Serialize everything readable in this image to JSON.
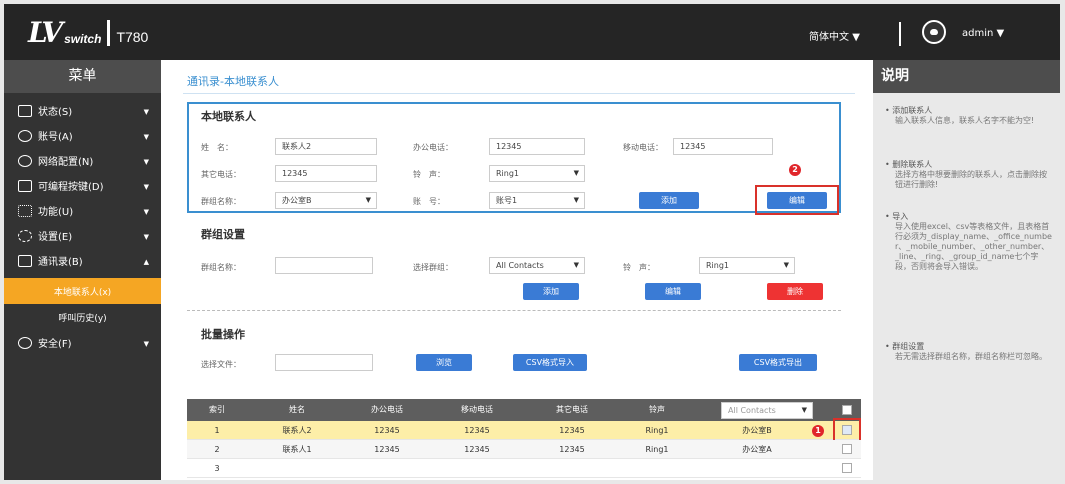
{
  "header": {
    "logo_main": "LV",
    "logo_sub": "switch",
    "model": "T780",
    "language": "简体中文",
    "user": "admin"
  },
  "sidebar": {
    "title": "菜单",
    "items": [
      {
        "label": "状态(S)",
        "caret": "▼"
      },
      {
        "label": "账号(A)",
        "caret": "▼"
      },
      {
        "label": "网络配置(N)",
        "caret": "▼"
      },
      {
        "label": "可编程按键(D)",
        "caret": "▼"
      },
      {
        "label": "功能(U)",
        "caret": "▼"
      },
      {
        "label": "设置(E)",
        "caret": "▼"
      },
      {
        "label": "通讯录(B)",
        "caret": "▲"
      }
    ],
    "subitems": [
      {
        "label": "本地联系人(x)"
      },
      {
        "label": "呼叫历史(y)"
      }
    ],
    "security": {
      "label": "安全(F)",
      "caret": "▼"
    }
  },
  "breadcrumb": "通讯录-本地联系人",
  "contact_form": {
    "title": "本地联系人",
    "name_label": "姓　名：",
    "name_value": "联系人2",
    "office_label": "办公电话：",
    "office_value": "12345",
    "mobile_label": "移动电话：",
    "mobile_value": "12345",
    "other_label": "其它电话：",
    "other_value": "12345",
    "ring_label": "铃　声：",
    "ring_value": "Ring1",
    "group_label": "群组名称：",
    "group_value": "办公室B",
    "account_label": "账　号：",
    "account_value": "账号1",
    "add_button": "添加",
    "edit_button": "编辑",
    "badge": "2"
  },
  "group_section": {
    "title": "群组设置",
    "name_label": "群组名称：",
    "name_value": "",
    "select_label": "选择群组：",
    "select_value": "All Contacts",
    "ring_label": "铃　声：",
    "ring_value": "Ring1",
    "add_button": "添加",
    "edit_button": "编辑",
    "delete_button": "删除"
  },
  "batch_section": {
    "title": "批量操作",
    "file_label": "选择文件：",
    "file_value": "",
    "browse_button": "浏览",
    "import_button": "CSV格式导入",
    "export_button": "CSV格式导出"
  },
  "table": {
    "columns": [
      "索引",
      "姓名",
      "办公电话",
      "移动电话",
      "其它电话",
      "铃声"
    ],
    "filter": "All Contacts",
    "rows": [
      {
        "index": "1",
        "name": "联系人2",
        "office": "12345",
        "mobile": "12345",
        "other": "12345",
        "ring": "Ring1",
        "group": "办公室B"
      },
      {
        "index": "2",
        "name": "联系人1",
        "office": "12345",
        "mobile": "12345",
        "other": "12345",
        "ring": "Ring1",
        "group": "办公室A"
      },
      {
        "index": "3",
        "name": "",
        "office": "",
        "mobile": "",
        "other": "",
        "ring": "",
        "group": ""
      }
    ],
    "badge": "1"
  },
  "help": {
    "title": "说明",
    "sections": [
      {
        "title": "添加联系人",
        "desc": "输入联系人信息，联系人名字不能为空!"
      },
      {
        "title": "删除联系人",
        "desc": "选择方格中想要删除的联系人，点击删除按钮进行删除!"
      },
      {
        "title": "导入",
        "desc": "导入使用excel、csv等表格文件，且表格首行必须为_display_name、_office_number、_mobile_number、_other_number、_line、_ring、_group_id_name七个字段，否则将会导入错误。"
      },
      {
        "title": "群组设置",
        "desc": "若无需选择群组名称，群组名称栏可忽略。"
      }
    ]
  }
}
